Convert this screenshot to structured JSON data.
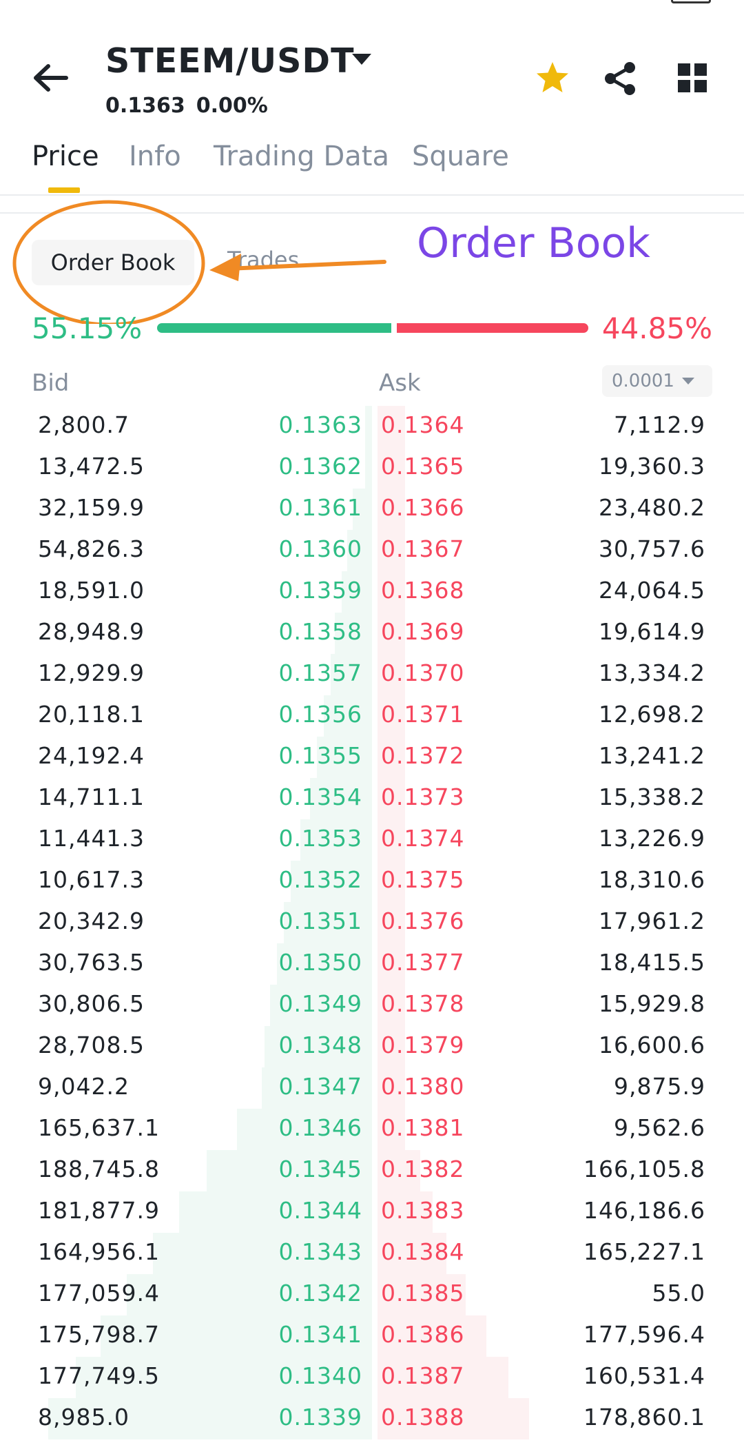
{
  "header": {
    "pair": "STEEM/USDT",
    "price": "0.1363",
    "change": "0.00%"
  },
  "tabs": [
    "Price",
    "Info",
    "Trading Data",
    "Square"
  ],
  "segments": {
    "order_book": "Order Book",
    "trades": "Trades"
  },
  "annotation": {
    "label": "Order Book"
  },
  "ratio": {
    "bid": "55.15%",
    "ask": "44.85%",
    "bid_fraction": 0.5515
  },
  "columns": {
    "bid": "Bid",
    "ask": "Ask",
    "precision": "0.0001"
  },
  "colors": {
    "buy": "#2ebd85",
    "sell": "#f6465d",
    "accent": "#f0b90b",
    "annotation": "#7b46e6",
    "highlight": "#f08a24"
  },
  "order_book": [
    {
      "bid_qty": "2,800.7",
      "bid": "0.1363",
      "ask": "0.1364",
      "ask_qty": "7,112.9"
    },
    {
      "bid_qty": "13,472.5",
      "bid": "0.1362",
      "ask": "0.1365",
      "ask_qty": "19,360.3"
    },
    {
      "bid_qty": "32,159.9",
      "bid": "0.1361",
      "ask": "0.1366",
      "ask_qty": "23,480.2"
    },
    {
      "bid_qty": "54,826.3",
      "bid": "0.1360",
      "ask": "0.1367",
      "ask_qty": "30,757.6"
    },
    {
      "bid_qty": "18,591.0",
      "bid": "0.1359",
      "ask": "0.1368",
      "ask_qty": "24,064.5"
    },
    {
      "bid_qty": "28,948.9",
      "bid": "0.1358",
      "ask": "0.1369",
      "ask_qty": "19,614.9"
    },
    {
      "bid_qty": "12,929.9",
      "bid": "0.1357",
      "ask": "0.1370",
      "ask_qty": "13,334.2"
    },
    {
      "bid_qty": "20,118.1",
      "bid": "0.1356",
      "ask": "0.1371",
      "ask_qty": "12,698.2"
    },
    {
      "bid_qty": "24,192.4",
      "bid": "0.1355",
      "ask": "0.1372",
      "ask_qty": "13,241.2"
    },
    {
      "bid_qty": "14,711.1",
      "bid": "0.1354",
      "ask": "0.1373",
      "ask_qty": "15,338.2"
    },
    {
      "bid_qty": "11,441.3",
      "bid": "0.1353",
      "ask": "0.1374",
      "ask_qty": "13,226.9"
    },
    {
      "bid_qty": "10,617.3",
      "bid": "0.1352",
      "ask": "0.1375",
      "ask_qty": "18,310.6"
    },
    {
      "bid_qty": "20,342.9",
      "bid": "0.1351",
      "ask": "0.1376",
      "ask_qty": "17,961.2"
    },
    {
      "bid_qty": "30,763.5",
      "bid": "0.1350",
      "ask": "0.1377",
      "ask_qty": "18,415.5"
    },
    {
      "bid_qty": "30,806.5",
      "bid": "0.1349",
      "ask": "0.1378",
      "ask_qty": "15,929.8"
    },
    {
      "bid_qty": "28,708.5",
      "bid": "0.1348",
      "ask": "0.1379",
      "ask_qty": "16,600.6"
    },
    {
      "bid_qty": "9,042.2",
      "bid": "0.1347",
      "ask": "0.1380",
      "ask_qty": "9,875.9"
    },
    {
      "bid_qty": "165,637.1",
      "bid": "0.1346",
      "ask": "0.1381",
      "ask_qty": "9,562.6"
    },
    {
      "bid_qty": "188,745.8",
      "bid": "0.1345",
      "ask": "0.1382",
      "ask_qty": "166,105.8"
    },
    {
      "bid_qty": "181,877.9",
      "bid": "0.1344",
      "ask": "0.1383",
      "ask_qty": "146,186.6"
    },
    {
      "bid_qty": "164,956.1",
      "bid": "0.1343",
      "ask": "0.1384",
      "ask_qty": "165,227.1"
    },
    {
      "bid_qty": "177,059.4",
      "bid": "0.1342",
      "ask": "0.1385",
      "ask_qty": "55.0"
    },
    {
      "bid_qty": "175,798.7",
      "bid": "0.1341",
      "ask": "0.1386",
      "ask_qty": "177,596.4"
    },
    {
      "bid_qty": "177,749.5",
      "bid": "0.1340",
      "ask": "0.1387",
      "ask_qty": "160,531.4"
    },
    {
      "bid_qty": "8,985.0",
      "bid": "0.1339",
      "ask": "0.1388",
      "ask_qty": "178,860.1"
    }
  ]
}
